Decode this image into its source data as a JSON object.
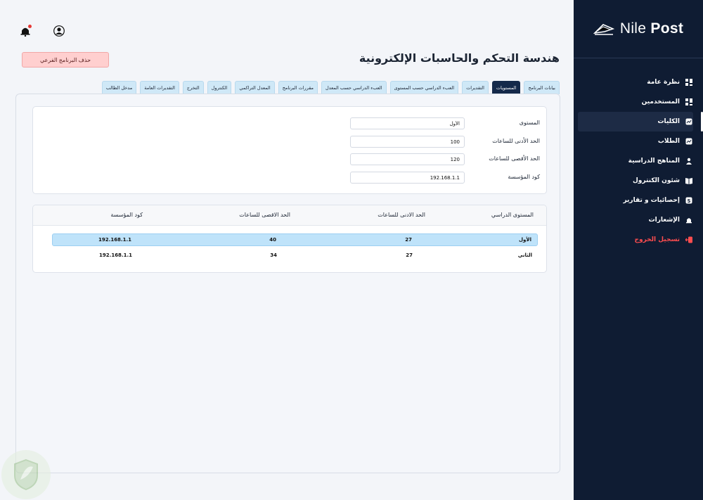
{
  "brand": {
    "logo_text_light": "Nile",
    "logo_text_bold": "Post"
  },
  "sidebar": {
    "items": [
      {
        "label": "نظرة عامة",
        "icon": "grid-icon"
      },
      {
        "label": "المستخدمين",
        "icon": "grid-icon"
      },
      {
        "label": "الكليات",
        "icon": "chart-icon",
        "active": true
      },
      {
        "label": "الطلاب",
        "icon": "chart-icon"
      },
      {
        "label": "المناهج الدراسية",
        "icon": "user-icon"
      },
      {
        "label": "شئون الكنترول",
        "icon": "book-icon"
      },
      {
        "label": "إحصائيات و تقارير",
        "icon": "dollar-icon"
      },
      {
        "label": "الإشعارات",
        "icon": "bell-icon"
      },
      {
        "label": "تسجيل الخروج",
        "icon": "logout-icon",
        "danger": true
      }
    ]
  },
  "header": {
    "title": "هندسة التحكم والحاسبات الإلكترونية",
    "delete_label": "حذف البرنامج الفرعي"
  },
  "tabs": [
    {
      "label": "بيانات البرنامج"
    },
    {
      "label": "المستويات",
      "active": true
    },
    {
      "label": "التقديرات"
    },
    {
      "label": "العبء الدراسي حسب المستوى"
    },
    {
      "label": "العبء الدراسي حسب المعدل"
    },
    {
      "label": "مقررات البرنامج"
    },
    {
      "label": "المعدل التراكمي"
    },
    {
      "label": "الكنترول"
    },
    {
      "label": "التخرج"
    },
    {
      "label": "التقديرات العامة"
    },
    {
      "label": "مدخل الطالب"
    }
  ],
  "form": {
    "level_label": "المستوى",
    "level_value": "الأول",
    "min_hours_label": "الحد الأدنى للساعات",
    "min_hours_value": "100",
    "max_hours_label": "الحد الأقصى للساعات",
    "max_hours_value": "120",
    "institution_label": "كود المؤسسة",
    "institution_value": "192.168.1.1"
  },
  "table": {
    "headers": [
      "المستوى الدراسي",
      "الحد الادنى للساعات",
      "الحد الاقصى للساعات",
      "كود المؤسسة"
    ],
    "rows": [
      {
        "level": "الأول",
        "min": "27",
        "max": "40",
        "code": "192.168.1.1",
        "selected": true
      },
      {
        "level": "الثاني",
        "min": "27",
        "max": "34",
        "code": "192.168.1.1"
      }
    ]
  },
  "colors": {
    "sidebar_bg": "#0f1c33",
    "active_tab": "#14294a",
    "tab_bg": "#cfe8f7",
    "selected_row": "#bfe3fa",
    "danger": "#ff4d4f"
  }
}
